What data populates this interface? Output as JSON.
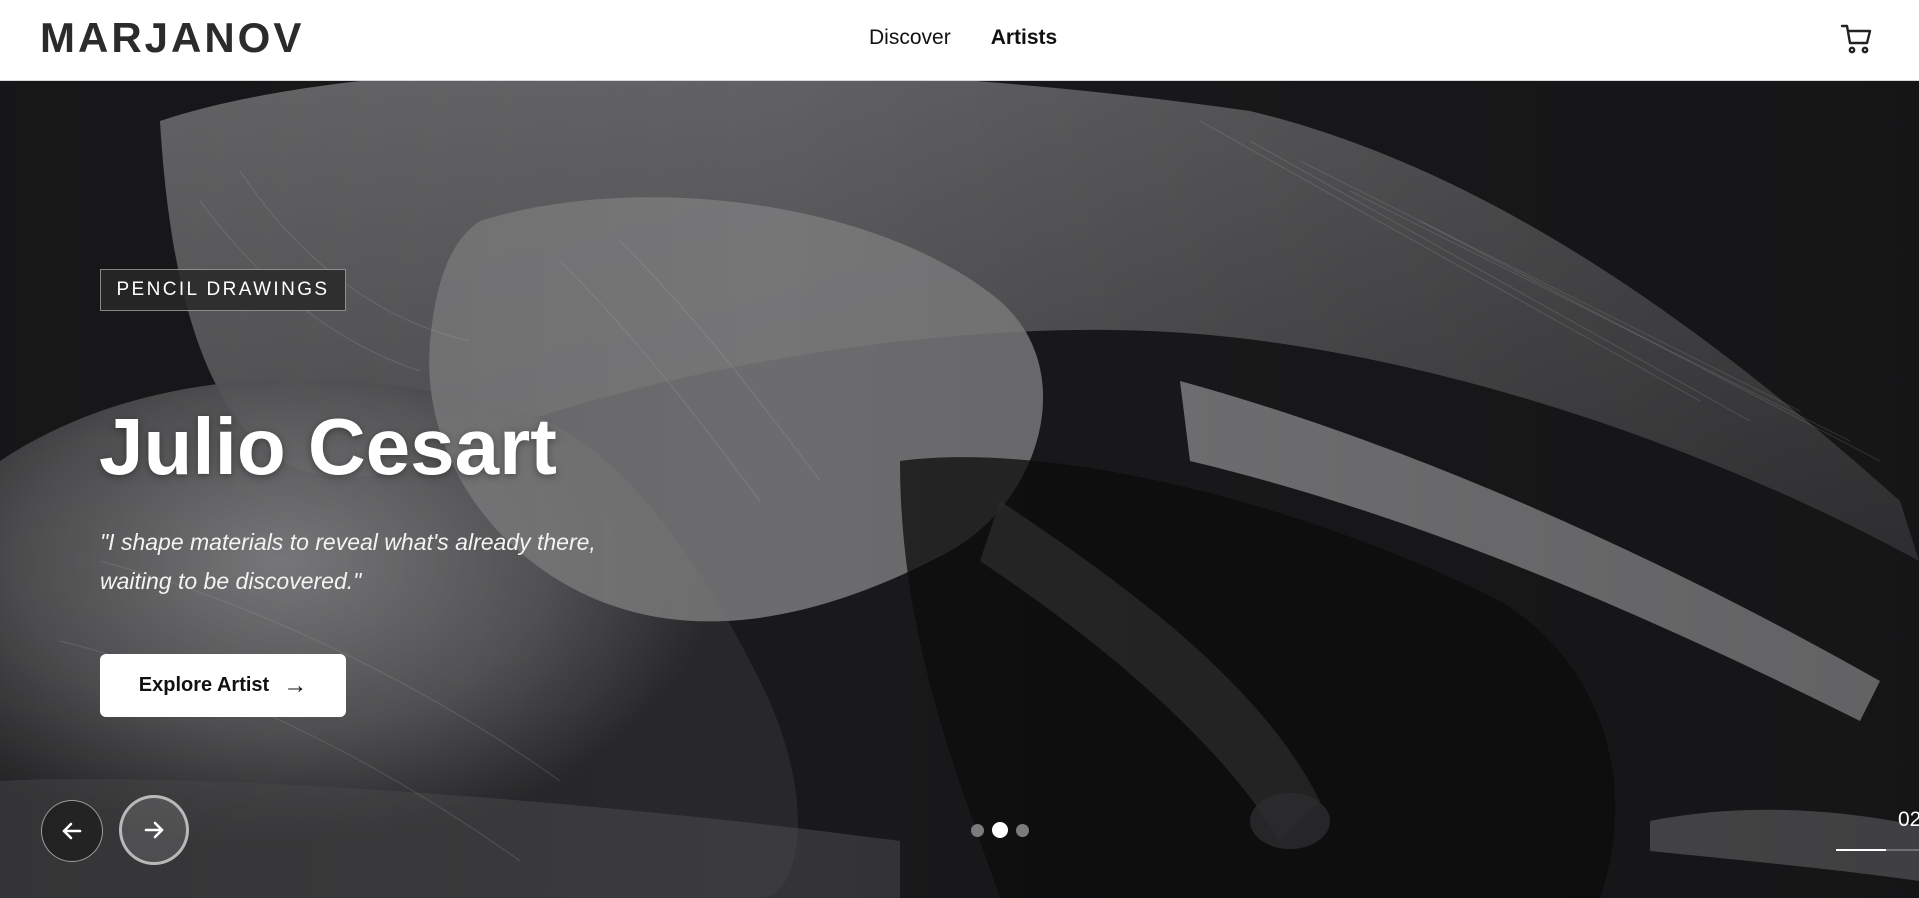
{
  "brand": {
    "logo_text": "MARJANOV"
  },
  "nav": {
    "items": [
      {
        "label": "Discover",
        "active": false
      },
      {
        "label": "Artists",
        "active": true
      }
    ]
  },
  "header": {
    "cart_icon": "cart-icon"
  },
  "hero": {
    "category": "PENCIL DRAWINGS",
    "artist_name": "Julio Cesart",
    "quote": "\"I shape materials to reveal what's already there, waiting to be discovered.\"",
    "cta_label": "Explore Artist",
    "cta_icon": "arrow-right-icon",
    "prev_icon": "arrow-left-icon",
    "next_icon": "arrow-right-icon",
    "slides": {
      "count": 3,
      "active_index": 1
    },
    "counter_text": "02",
    "progress": 0.6
  },
  "colors": {
    "accent": "#ffffff",
    "header_bg": "#ffffff",
    "hero_bg": "#141416"
  }
}
